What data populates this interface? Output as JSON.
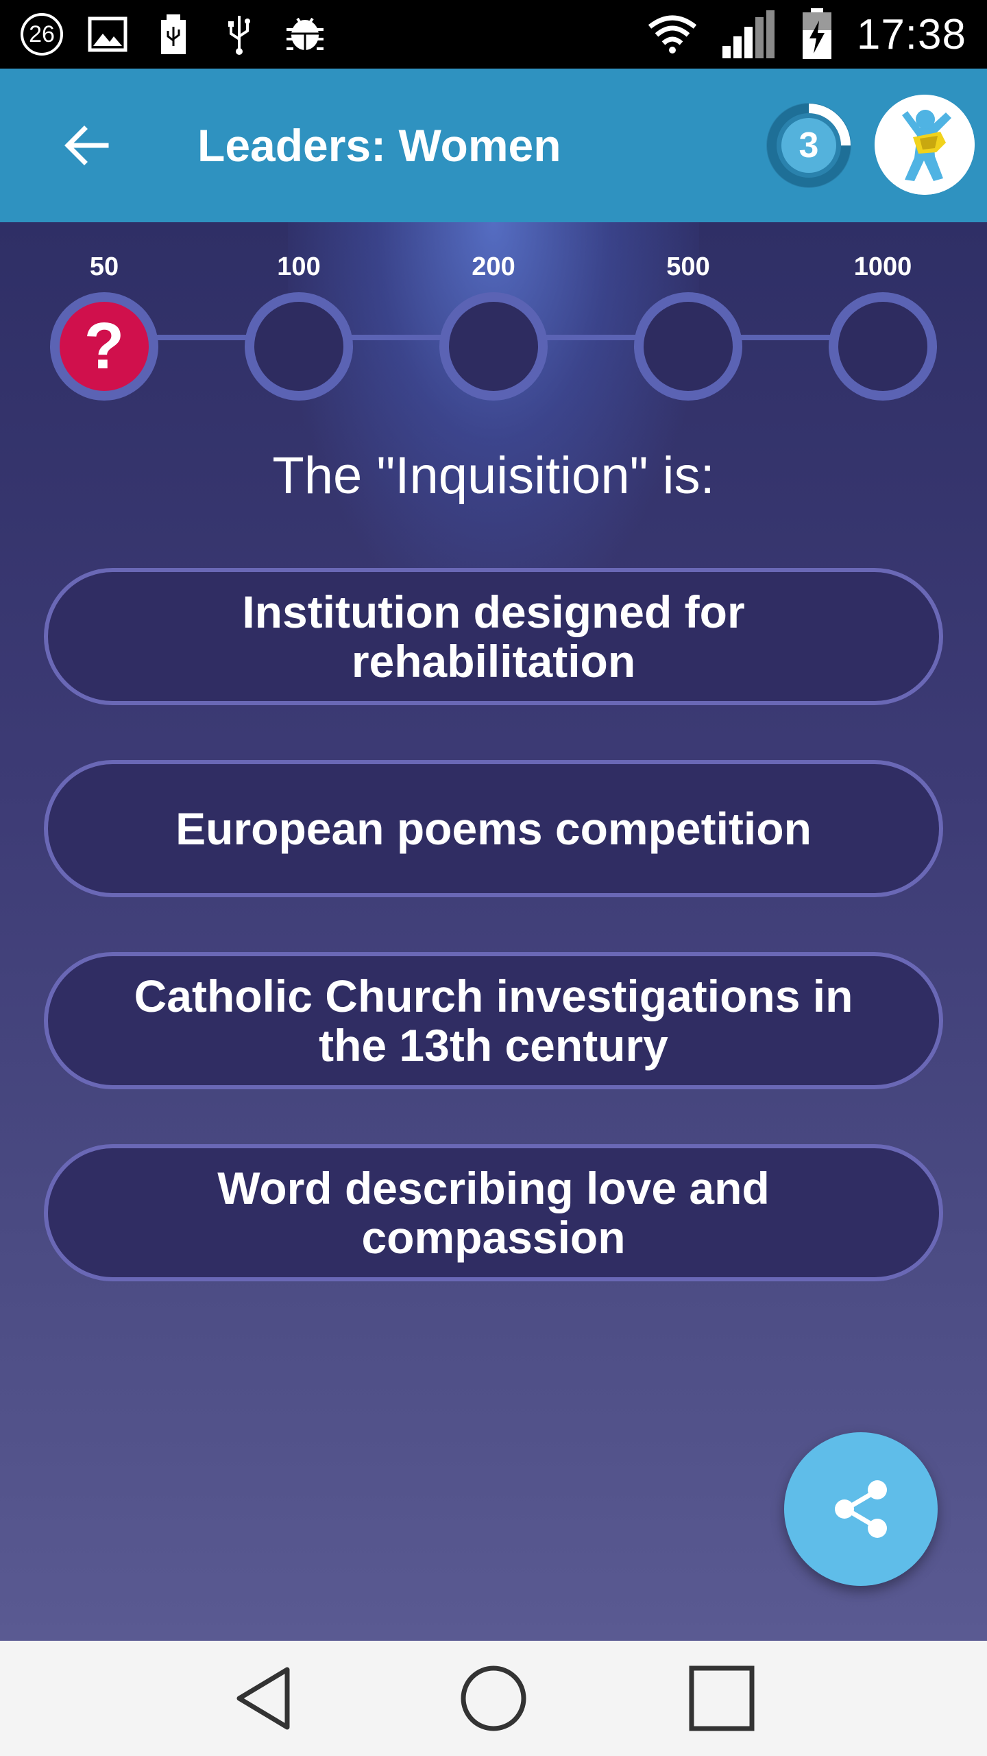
{
  "status_bar": {
    "notification_count": "26",
    "icons": [
      "notification-count-icon",
      "image-icon",
      "usb-icon",
      "usb-debug-icon",
      "android-debug-icon",
      "wifi-icon",
      "signal-icon",
      "battery-charging-icon"
    ],
    "time": "17:38"
  },
  "app_bar": {
    "title": "Leaders: Women",
    "level": "3",
    "level_progress": 0.25,
    "colors": {
      "background": "#2f92c0"
    }
  },
  "ladder": {
    "steps": [
      {
        "value": "50",
        "marker": "?",
        "active": true
      },
      {
        "value": "100",
        "marker": "",
        "active": false
      },
      {
        "value": "200",
        "marker": "",
        "active": false
      },
      {
        "value": "500",
        "marker": "",
        "active": false
      },
      {
        "value": "1000",
        "marker": "",
        "active": false
      }
    ]
  },
  "question": {
    "text": "The \"Inquisition\" is:"
  },
  "answers": [
    {
      "label": "Institution designed for rehabilitation"
    },
    {
      "label": "European poems competition"
    },
    {
      "label": "Catholic Church investigations in the 13th century"
    },
    {
      "label": "Word describing love and compassion"
    }
  ],
  "share_button": {
    "icon": "share-icon",
    "color": "#5fbde9"
  },
  "nav_bar": {
    "icons": [
      "back-triangle-icon",
      "home-circle-icon",
      "recents-square-icon"
    ]
  }
}
